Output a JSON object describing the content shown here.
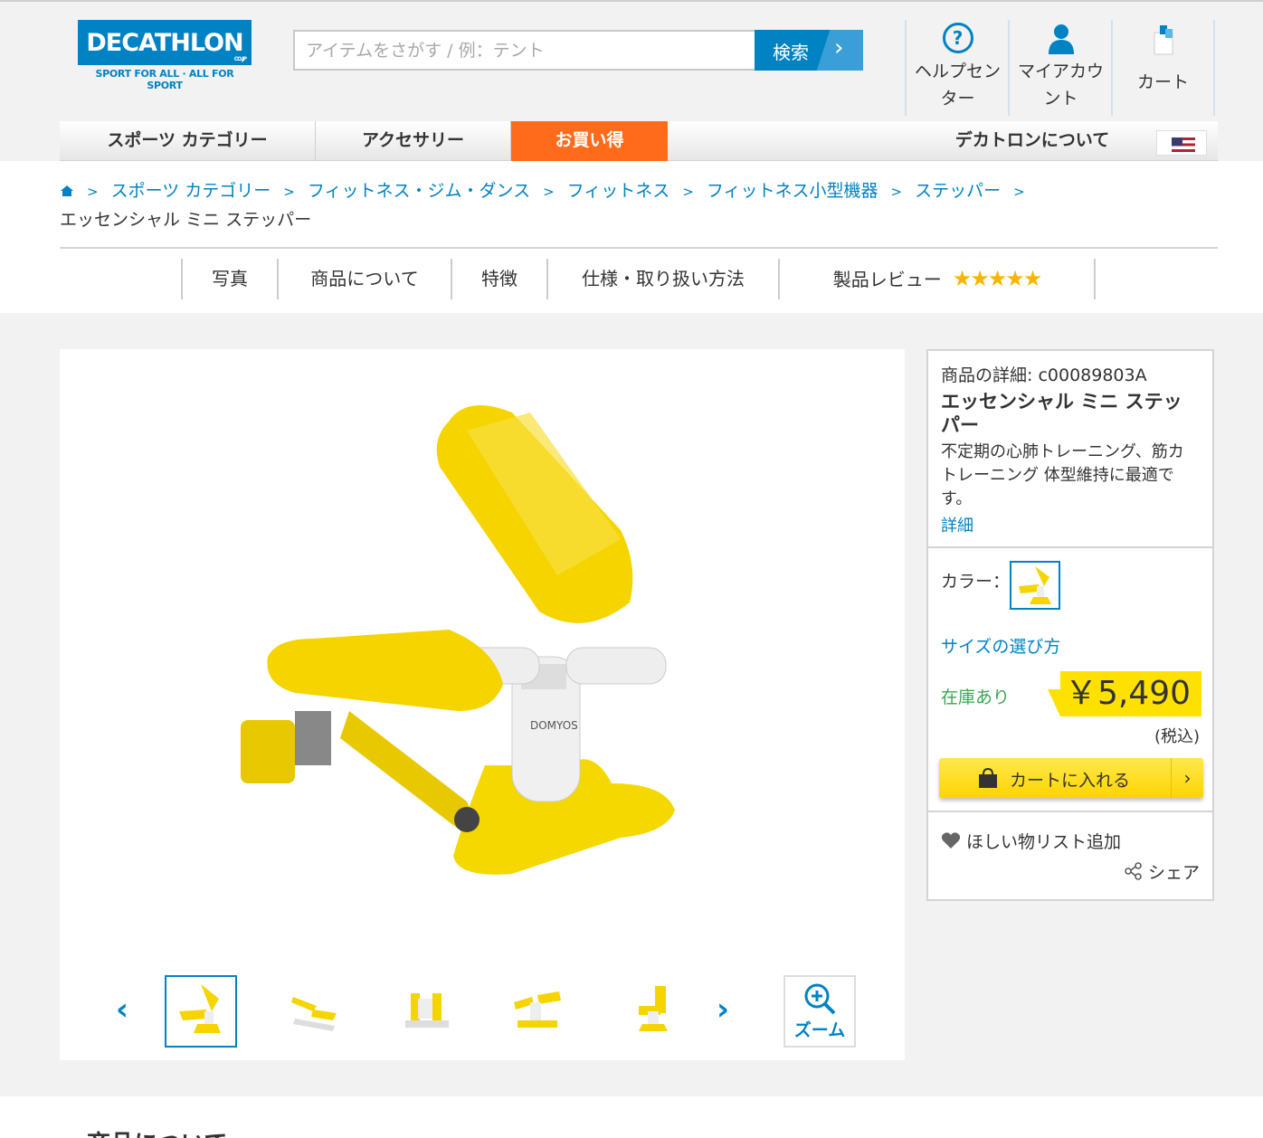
{
  "brand": {
    "name": "DECATHLON",
    "co": "CO.JP",
    "tagline": "SPORT FOR ALL · ALL FOR SPORT"
  },
  "search": {
    "placeholder": "アイテムをさがす / 例：テント",
    "button_label": "検索"
  },
  "header_nav": [
    {
      "label": "ヘルプセンター",
      "icon": "help-icon"
    },
    {
      "label": "マイアカウント",
      "icon": "account-icon"
    },
    {
      "label": "カート",
      "icon": "cart-icon"
    }
  ],
  "main_nav": [
    {
      "label": "スポーツ カテゴリー"
    },
    {
      "label": "アクセサリー"
    },
    {
      "label": "お買い得"
    },
    {
      "label": "デカトロンについて"
    }
  ],
  "breadcrumb": {
    "items": [
      "スポーツ カテゴリー",
      "フィットネス・ジム・ダンス",
      "フィットネス",
      "フィットネス小型機器",
      "ステッパー"
    ],
    "current": "エッセンシャル ミニ ステッパー",
    "separator": ">"
  },
  "tabs": [
    "写真",
    "商品について",
    "特徴",
    "仕様・取り扱い方法",
    "製品レビュー"
  ],
  "review": {
    "stars": "★★★★★"
  },
  "product": {
    "id_text": "商品の詳細: c00089803A",
    "name": "エッセンシャル ミニ ステッパー",
    "description": "不定期の心肺トレーニング、筋カトレーニング 体型維持に最適です。",
    "more_link": "詳細",
    "color_label": "カラー：",
    "size_guide": "サイズの選び方",
    "stock": "在庫あり",
    "price": "￥5,490",
    "tax_note": "(税込)",
    "cart_button": "カートに入れる",
    "wishlist": "ほしい物リスト追加",
    "share": "シェア"
  },
  "gallery": {
    "zoom_label": "ズーム",
    "thumbnail_count": 5,
    "selected_index": 0
  },
  "section_title": "商品について",
  "colors": {
    "brand_blue": "#0082c3",
    "deal_orange": "#ff6b1a",
    "price_yellow": "#ffe100",
    "stock_green": "#3aa655",
    "star": "#f7b500"
  }
}
